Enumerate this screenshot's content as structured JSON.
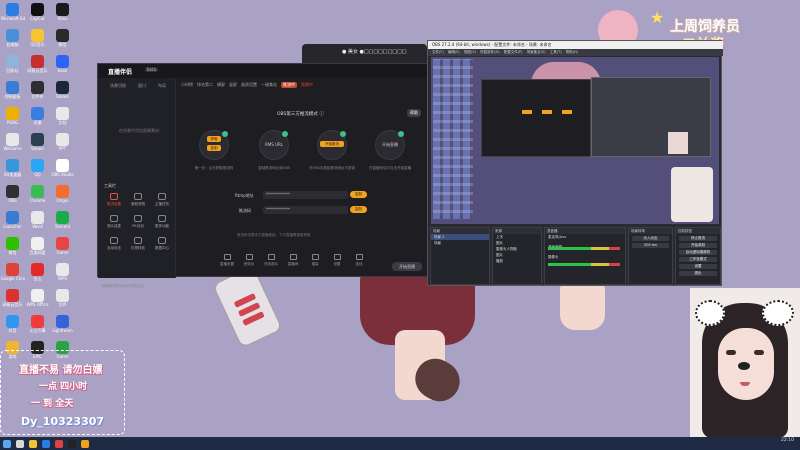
{
  "desktop": {
    "icons": [
      {
        "label": "Microsoft Edge",
        "color": "#2a7de1"
      },
      {
        "label": "CapCut",
        "color": "#111111"
      },
      {
        "label": "Xbox",
        "color": "#1a1a1a"
      },
      {
        "label": "此电脑",
        "color": "#4a90d9"
      },
      {
        "label": "QQ音乐",
        "color": "#f4c531"
      },
      {
        "label": "微信",
        "color": "#2a2a2a"
      },
      {
        "label": "回收站",
        "color": "#8fb4d9"
      },
      {
        "label": "网易云音乐",
        "color": "#c62f2f"
      },
      {
        "label": "Kook",
        "color": "#2e64f5"
      },
      {
        "label": "控制面板",
        "color": "#3a7bd5"
      },
      {
        "label": "文件夹",
        "color": "#2e2e2e"
      },
      {
        "label": "Steam",
        "color": "#1b2838"
      },
      {
        "label": "PUBG",
        "color": "#f0b000"
      },
      {
        "label": "迅雷",
        "color": "#3b7de1"
      },
      {
        "label": "文档",
        "color": "#e8e8e8"
      },
      {
        "label": "WeGame",
        "color": "#e8e8e8"
      },
      {
        "label": "Steam",
        "color": "#2c3e50"
      },
      {
        "label": "PPT",
        "color": "#e8e8e8"
      },
      {
        "label": "UU加速器",
        "color": "#3498db"
      },
      {
        "label": "QQ",
        "color": "#2aa6f5"
      },
      {
        "label": "OBS Studio",
        "color": "#ffffff"
      },
      {
        "label": "OBS",
        "color": "#303030"
      },
      {
        "label": "Chrome",
        "color": "#3cba54"
      },
      {
        "label": "Origin",
        "color": "#f56c2d"
      },
      {
        "label": "Launcher",
        "color": "#3a7bd5"
      },
      {
        "label": "Word",
        "color": "#e8e8e8"
      },
      {
        "label": "Tencent",
        "color": "#1bab4a"
      },
      {
        "label": "微信",
        "color": "#2dc100"
      },
      {
        "label": "百度网盘",
        "color": "#f0f0f0"
      },
      {
        "label": "Game",
        "color": "#e84545"
      },
      {
        "label": "Google Chrome",
        "color": "#db4437"
      },
      {
        "label": "金山",
        "color": "#e02b2b"
      },
      {
        "label": "WPS",
        "color": "#e8e8e8"
      },
      {
        "label": "网易云音乐",
        "color": "#d9322f"
      },
      {
        "label": "WPS Office",
        "color": "#f0f0f0"
      },
      {
        "label": "文件",
        "color": "#e8e8e8"
      },
      {
        "label": "抖音",
        "color": "#3296f0"
      },
      {
        "label": "火山引擎",
        "color": "#ec3c3c"
      },
      {
        "label": "Lightroom",
        "color": "#3465d8"
      },
      {
        "label": "游戏",
        "color": "#f0b432"
      },
      {
        "label": "EPIC",
        "color": "#222222"
      },
      {
        "label": "Game",
        "color": "#2ba245"
      }
    ]
  },
  "banner": {
    "line1": "上周饲养员",
    "line2": "二兰酱"
  },
  "promo": {
    "line1": "直播不易 请勿白嫖",
    "line2": "一点 四小时",
    "line3": "一 到 全天",
    "line4": "Dy_10323307"
  },
  "popup": {
    "text": "● 美女 ●□□□□□□□□□"
  },
  "app": {
    "logo": "直播伴侣",
    "version": "beta",
    "left_tabs": [
      "场景切换",
      "窗口",
      "布局"
    ],
    "hint": "在场景中添加直播素材",
    "tools_title": "工具栏",
    "tools": [
      {
        "label": "推流设置",
        "active": true
      },
      {
        "label": "美颜滤镜",
        "active": false
      },
      {
        "label": "主播任务",
        "active": false
      },
      {
        "label": "观众连麦",
        "active": false
      },
      {
        "label": "PK对战",
        "active": false
      },
      {
        "label": "更多功能",
        "active": false
      },
      {
        "label": "互动玩法",
        "active": false
      },
      {
        "label": "礼物特效",
        "active": false
      },
      {
        "label": "数据中心",
        "active": false
      }
    ],
    "footer": "使用前请先阅读并同意协议",
    "topbar": [
      "小时榜",
      "排名第二",
      "横屏",
      "竖屏",
      "画质设置",
      "一键美化",
      "推流中",
      "直播中"
    ],
    "mode_header": "OBS第三方推流模式 ⓘ",
    "help": "帮助",
    "steps": [
      {
        "label": "",
        "desc": "第一步：点击获取推流码",
        "btn": "获取",
        "btn2": "复制"
      },
      {
        "label": "RMS URL",
        "desc": "复制推流地址到OBS",
        "btn": "",
        "btn2": ""
      },
      {
        "label": "",
        "desc": "在OBS中粘贴推流地址与密钥",
        "btn": "开始推流",
        "btn2": ""
      },
      {
        "label": "开始直播",
        "desc": "在直播伴侣中点击开始直播",
        "btn": "",
        "btn2": ""
      }
    ],
    "rtmp_label": "Rtmp地址",
    "rtmp_value": "************",
    "key_label": "推流码",
    "key_value": "************",
    "copy_label": "复制",
    "note": "推流码仅限本次直播使用，下次直播需重新获取",
    "bottom_tools": [
      "直播设置",
      "音效台",
      "在线观众",
      "直播间",
      "福袋",
      "设置",
      "连线"
    ],
    "golive": "开始直播"
  },
  "obs": {
    "title": "OBS 27.2.4 (64-bit, windows) - 配置文件: 未命名 - 场景: 未命名",
    "menu": "文件(F) 编辑(E) 视图(V) 停靠部件(D) 配置文件(P) 场景集合(S) 工具(T) 帮助(H)",
    "panels": {
      "scenes_title": "场景",
      "scenes": [
        "场景 2",
        "场景"
      ],
      "sources_title": "来源",
      "sources": [
        "上字",
        "图片",
        "摄像头人物脸",
        "图片",
        "播放"
      ],
      "mixer_title": "混音器",
      "mixer": [
        "麦克风/Aux",
        "桌面音频",
        "摄像头"
      ],
      "transitions_title": "场景转场",
      "transition": "淡入淡出",
      "duration": "300 ms",
      "controls_title": "控制按钮",
      "controls": [
        "停止推流",
        "开始录制",
        "启动虚拟摄像机",
        "工作室模式",
        "设置",
        "退出"
      ]
    },
    "status": "LIVE: 00:36:11  REC: 00:00:00  CPU: 3.4%, 30.00 fps"
  },
  "taskbar": {
    "time": "22:10",
    "date": "2022/3/6"
  }
}
